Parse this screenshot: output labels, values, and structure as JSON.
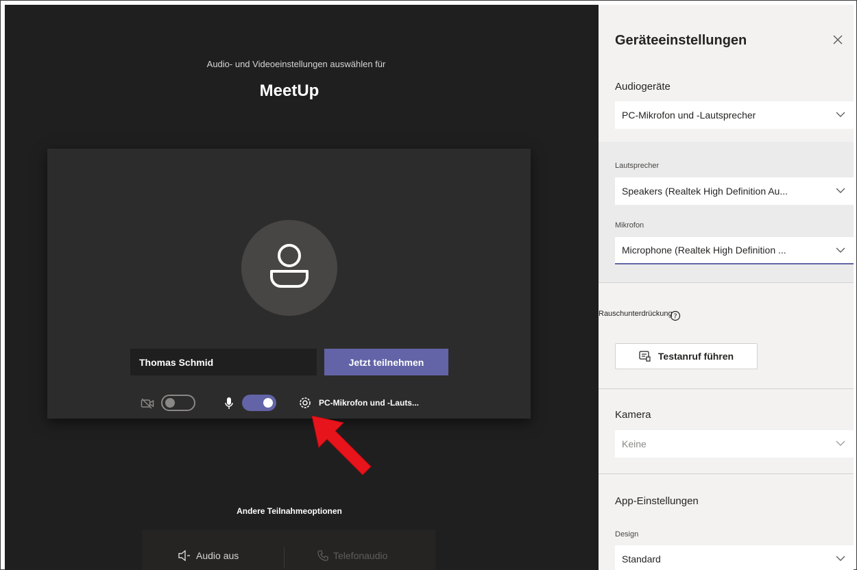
{
  "prejoin": {
    "subtitle": "Audio- und Videoeinstellungen auswählen für",
    "meeting_title": "MeetUp",
    "name_input_value": "Thomas Schmid",
    "join_label": "Jetzt teilnehmen",
    "camera_toggle_on": false,
    "mic_toggle_on": true,
    "device_label": "PC-Mikrofon und -Lauts...",
    "other_options_label": "Andere Teilnahmeoptionen",
    "audio_off_label": "Audio aus",
    "phone_audio_label": "Telefonaudio"
  },
  "settings": {
    "title": "Geräteeinstellungen",
    "audio_devices_label": "Audiogeräte",
    "audio_device_value": "PC-Mikrofon und -Lautsprecher",
    "speaker_label": "Lautsprecher",
    "speaker_value": "Speakers (Realtek High Definition Au...",
    "mic_label": "Mikrofon",
    "mic_value": "Microphone (Realtek High Definition ...",
    "noise_label": "Rauschunterdrückung",
    "test_call_label": "Testanruf führen",
    "camera_label": "Kamera",
    "camera_value": "Keine",
    "app_settings_label": "App-Einstellungen",
    "design_label": "Design",
    "design_value": "Standard"
  },
  "colors": {
    "stage_bg": "#1f1f1f",
    "preview_bg": "#2d2c2c",
    "accent": "#6264a7",
    "panel_bg": "#f3f2f1",
    "annotation_arrow": "#e8141c"
  },
  "icons": {
    "avatar": "person-icon",
    "camera": "camera-off-icon",
    "mic": "microphone-icon",
    "device_settings": "gear-icon",
    "close": "close-icon",
    "help": "help-icon",
    "test_call": "test-call-icon",
    "audio_off": "speaker-off-icon",
    "phone": "phone-icon",
    "dropdown": "chevron-down-icon"
  }
}
